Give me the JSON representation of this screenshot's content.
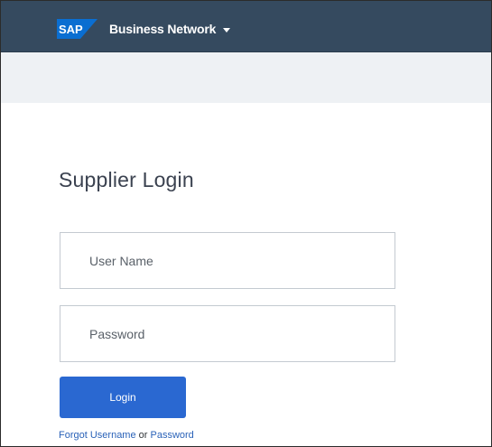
{
  "header": {
    "logo_text": "SAP",
    "brand_label": "Business Network",
    "brand_menu_icon": "caret-down-icon",
    "background_color": "#354a5f",
    "logo_color": "#0a6ed1"
  },
  "login": {
    "title": "Supplier Login",
    "username_placeholder": "User Name",
    "password_placeholder": "Password",
    "button_label": "Login",
    "button_color": "#2a68d1",
    "forgot_username_link": "Forgot Username",
    "forgot_or_text": " or ",
    "forgot_password_link": "Password"
  }
}
